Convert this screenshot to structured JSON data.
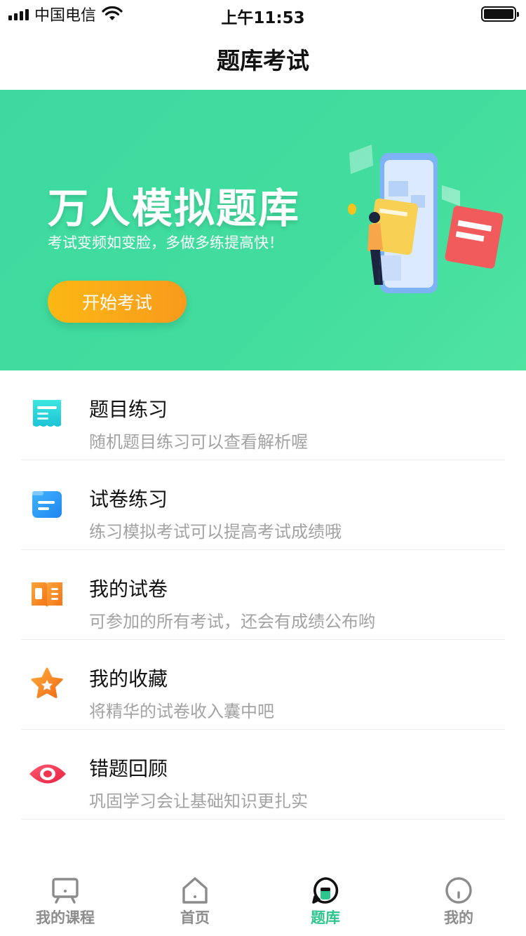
{
  "status_bar": {
    "carrier": "中国电信",
    "time": "上午11:53"
  },
  "nav": {
    "title": "题库考试"
  },
  "banner": {
    "title": "万人模拟题库",
    "subtitle": "考试变频如变脸，多做多练提高快！",
    "button_label": "开始考试",
    "bg_color": "#3fdb9f",
    "button_color": "#f9a91a"
  },
  "list": {
    "items": [
      {
        "title": "题目练习",
        "desc": "随机题目练习可以查看解析喔",
        "icon": "question-sheet-icon",
        "color": "#27d3d8"
      },
      {
        "title": "试卷练习",
        "desc": "练习模拟考试可以提高考试成绩哦",
        "icon": "paper-icon",
        "color": "#2b9bf5"
      },
      {
        "title": "我的试卷",
        "desc": "可参加的所有考试，还会有成绩公布哟",
        "icon": "open-book-icon",
        "color": "#f98a1e"
      },
      {
        "title": "我的收藏",
        "desc": "将精华的试卷收入囊中吧",
        "icon": "star-icon",
        "color": "#f98a1e"
      },
      {
        "title": "错题回顾",
        "desc": "巩固学习会让基础知识更扎实",
        "icon": "eye-icon",
        "color": "#f23a55"
      }
    ]
  },
  "tabbar": {
    "tabs": [
      {
        "label": "我的课程",
        "icon": "presentation-board-icon",
        "active": false
      },
      {
        "label": "首页",
        "icon": "home-icon",
        "active": false
      },
      {
        "label": "题库",
        "icon": "question-bank-icon",
        "active": true
      },
      {
        "label": "我的",
        "icon": "profile-icon",
        "active": false
      }
    ],
    "active_color": "#2ec58d",
    "inactive_color": "#8c8c8c"
  }
}
